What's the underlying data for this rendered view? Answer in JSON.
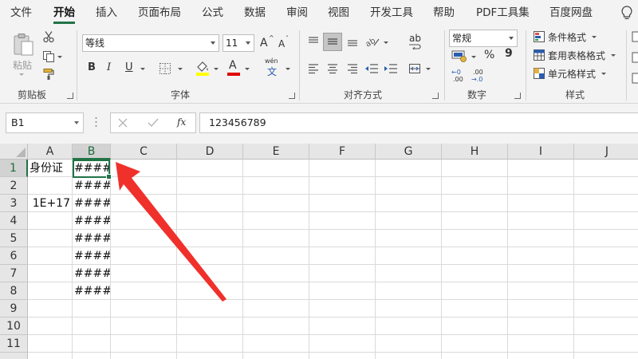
{
  "menu_tabs": [
    "文件",
    "开始",
    "插入",
    "页面布局",
    "公式",
    "数据",
    "审阅",
    "视图",
    "开发工具",
    "帮助",
    "PDF工具集",
    "百度网盘"
  ],
  "active_tab": "开始",
  "clipboard": {
    "paste_label": "粘贴",
    "group_label": "剪贴板"
  },
  "font": {
    "name": "等线",
    "size": "11",
    "bold": "B",
    "italic": "I",
    "underline": "U",
    "grow": "A",
    "shrink": "A",
    "font_color_letter": "A",
    "phonetic": "wén",
    "phonetic_char": "文",
    "group_label": "字体"
  },
  "alignment": {
    "group_label": "对齐方式",
    "wrap_text_icon": "ab"
  },
  "number": {
    "format": "常规",
    "percent": "%",
    "comma": "9",
    "inc_decimal_top": "←0",
    "inc_decimal_bottom": ".00",
    "dec_decimal_top": ".00",
    "dec_decimal_bottom": "→.0",
    "group_label": "数字"
  },
  "styles": {
    "conditional": "条件格式",
    "as_table": "套用表格格式",
    "cell_styles": "单元格样式",
    "group_label": "样式"
  },
  "formula_bar": {
    "name_box": "B1",
    "fx": "fx",
    "value": "123456789"
  },
  "columns": [
    "A",
    "B",
    "C",
    "D",
    "E",
    "F",
    "G",
    "H",
    "I",
    "J"
  ],
  "selected_column": "B",
  "rows": [
    "1",
    "2",
    "3",
    "4",
    "5",
    "6",
    "7",
    "8",
    "9",
    "10",
    "11"
  ],
  "selected_row": "1",
  "cells": {
    "A1": "身份证",
    "A3": "1E+17",
    "B1": "####",
    "B2": "####",
    "B3": "####",
    "B4": "####",
    "B5": "####",
    "B6": "####",
    "B7": "####",
    "B8": "####"
  },
  "colors": {
    "accent_green": "#217346",
    "annotation_red": "#f0302a",
    "highlight_yellow": "#ffff00",
    "font_red": "#e00000"
  }
}
